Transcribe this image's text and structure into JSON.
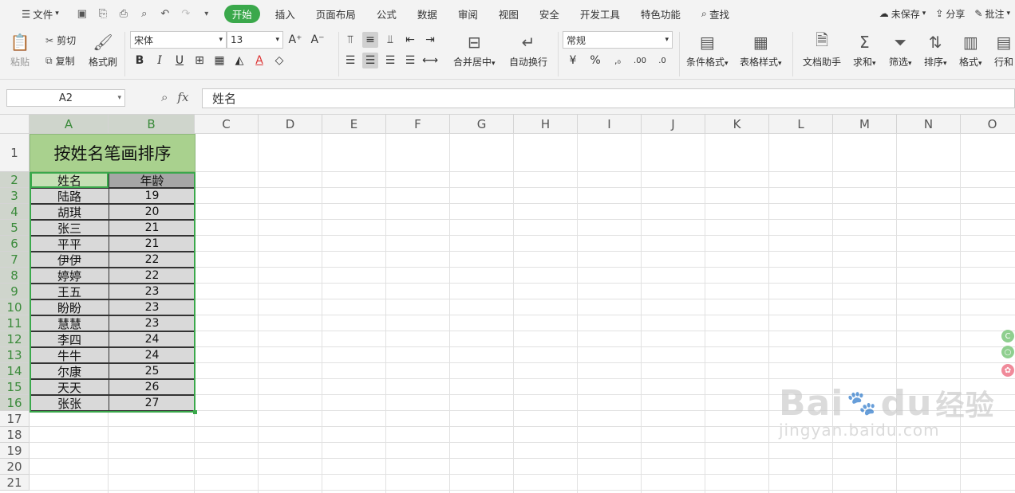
{
  "menu": {
    "file": "文件",
    "tabs": [
      "开始",
      "插入",
      "页面布局",
      "公式",
      "数据",
      "审阅",
      "视图",
      "安全",
      "开发工具",
      "特色功能"
    ],
    "search": "查找",
    "unsaved": "未保存",
    "share": "分享",
    "comment": "批注"
  },
  "ribbon": {
    "paste": "粘贴",
    "cut": "剪切",
    "copy": "复制",
    "format_painter": "格式刷",
    "font_name": "宋体",
    "font_size": "13",
    "merge_center": "合并居中",
    "wrap_text": "自动换行",
    "number_format": "常规",
    "conditional_format": "条件格式",
    "table_style": "表格样式",
    "doc_assistant": "文档助手",
    "sum": "求和",
    "filter": "筛选",
    "sort": "排序",
    "format": "格式",
    "row_col": "行和"
  },
  "formula_bar": {
    "name_box": "A2",
    "fx": "fx",
    "content": "姓名"
  },
  "sheet": {
    "columns": [
      "A",
      "B",
      "C",
      "D",
      "E",
      "F",
      "G",
      "H",
      "I",
      "J",
      "K",
      "L",
      "M",
      "N",
      "O"
    ],
    "rows": [
      "1",
      "2",
      "3",
      "4",
      "5",
      "6",
      "7",
      "8",
      "9",
      "10",
      "11",
      "12",
      "13",
      "14",
      "15",
      "16",
      "17",
      "18",
      "19",
      "20",
      "21"
    ],
    "title": "按姓名笔画排序",
    "headers": [
      "姓名",
      "年龄"
    ],
    "data": [
      [
        "陆路",
        "19"
      ],
      [
        "胡琪",
        "20"
      ],
      [
        "张三",
        "21"
      ],
      [
        "平平",
        "21"
      ],
      [
        "伊伊",
        "22"
      ],
      [
        "婷婷",
        "22"
      ],
      [
        "王五",
        "23"
      ],
      [
        "盼盼",
        "23"
      ],
      [
        "慧慧",
        "23"
      ],
      [
        "李四",
        "24"
      ],
      [
        "牛牛",
        "24"
      ],
      [
        "尔康",
        "25"
      ],
      [
        "天天",
        "26"
      ],
      [
        "张张",
        "27"
      ]
    ]
  },
  "watermark": {
    "brand": "Bai",
    "brand2": "du",
    "cn": "经验",
    "url": "jingyan.baidu.com"
  },
  "colors": {
    "accent": "#3aa84b",
    "title_fill": "#a9d18e",
    "header_a": "#c5e0b4",
    "header_b": "#a6a6a6",
    "data_fill": "#d9d9d9"
  }
}
